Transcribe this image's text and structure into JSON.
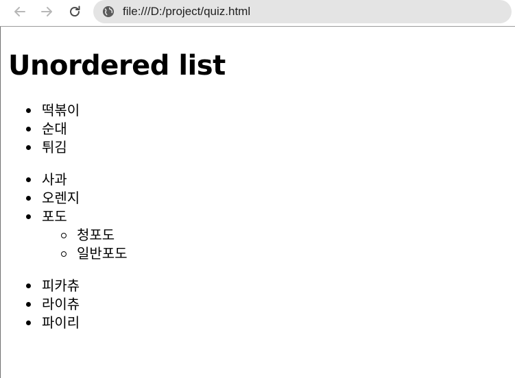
{
  "browser": {
    "url": "file:///D:/project/quiz.html"
  },
  "page": {
    "heading": "Unordered list",
    "list1": [
      "떡볶이",
      "순대",
      "튀김"
    ],
    "list2": {
      "items": [
        "사과",
        "오렌지",
        "포도"
      ],
      "sublist": [
        "청포도",
        "일반포도"
      ]
    },
    "list3": [
      "피카츄",
      "라이츄",
      "파이리"
    ]
  }
}
